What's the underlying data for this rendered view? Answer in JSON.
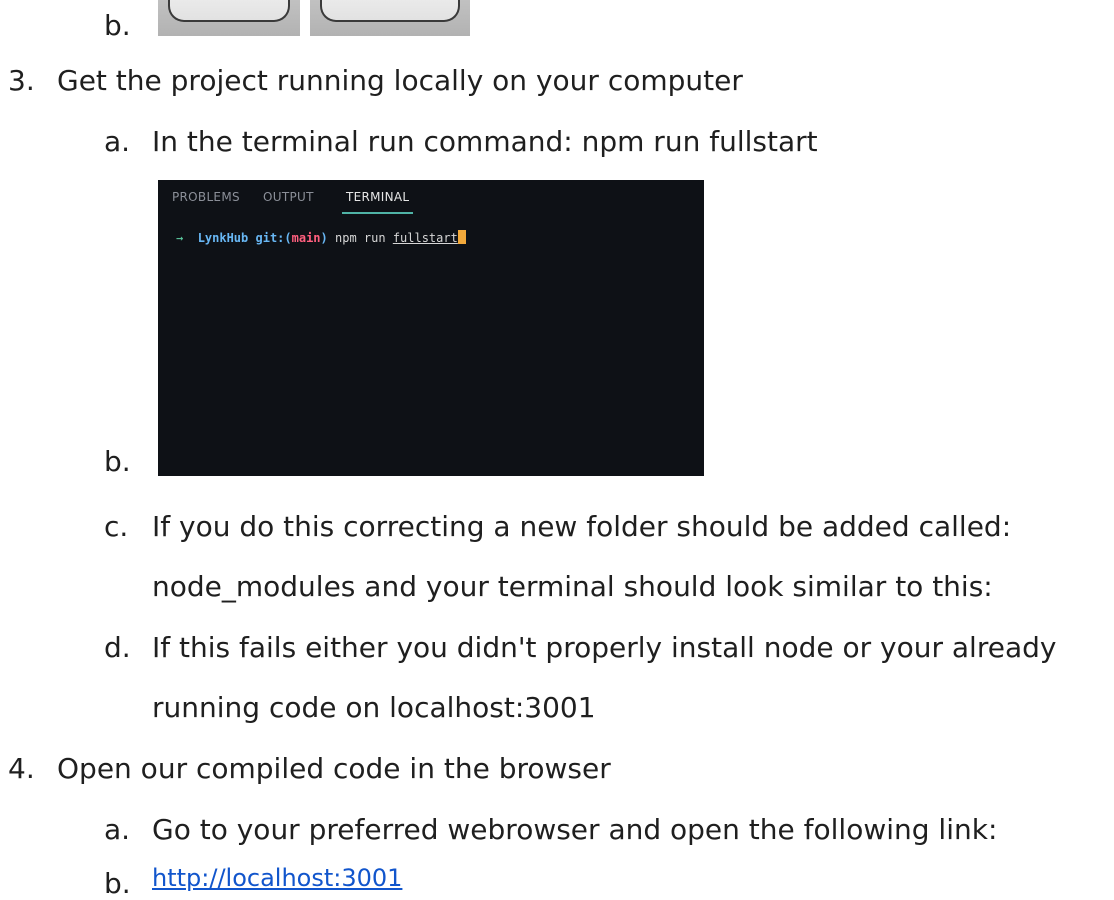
{
  "doc": {
    "step2": {
      "sub_b_marker": "b."
    },
    "step3": {
      "marker": "3.",
      "text": "Get the project running locally on your computer",
      "a": {
        "marker": "a.",
        "text": "In the terminal run command: npm run fullstart"
      },
      "b": {
        "marker": "b."
      },
      "c": {
        "marker": "c.",
        "line1": "If you do this correcting a new folder should be added called:",
        "line2": "node_modules and your terminal should look similar to this:"
      },
      "d": {
        "marker": "d.",
        "line1": "If this fails either you didn't properly install node or your already",
        "line2": "running code on localhost:3001"
      }
    },
    "step4": {
      "marker": "4.",
      "text": "Open our compiled code in the browser",
      "a": {
        "marker": "a.",
        "text": "Go to your preferred webrowser and open the following link:"
      },
      "b": {
        "marker": "b.",
        "link": "http://localhost:3001"
      }
    }
  },
  "terminal": {
    "tabs": [
      "PROBLEMS",
      "OUTPUT",
      "TERMINAL"
    ],
    "active_tab": "TERMINAL",
    "prompt": {
      "arrow": "→",
      "repo": "LynkHub",
      "git": "git:(",
      "branch": "main",
      "git_close": ")",
      "command": "npm run",
      "argument": "fullstart"
    },
    "colors": {
      "background": "#0e1116",
      "accent": "#4fb3a6",
      "cursor": "#f2a93b"
    }
  },
  "colors": {
    "text": "#1f1f1f",
    "link": "#1155cc"
  }
}
